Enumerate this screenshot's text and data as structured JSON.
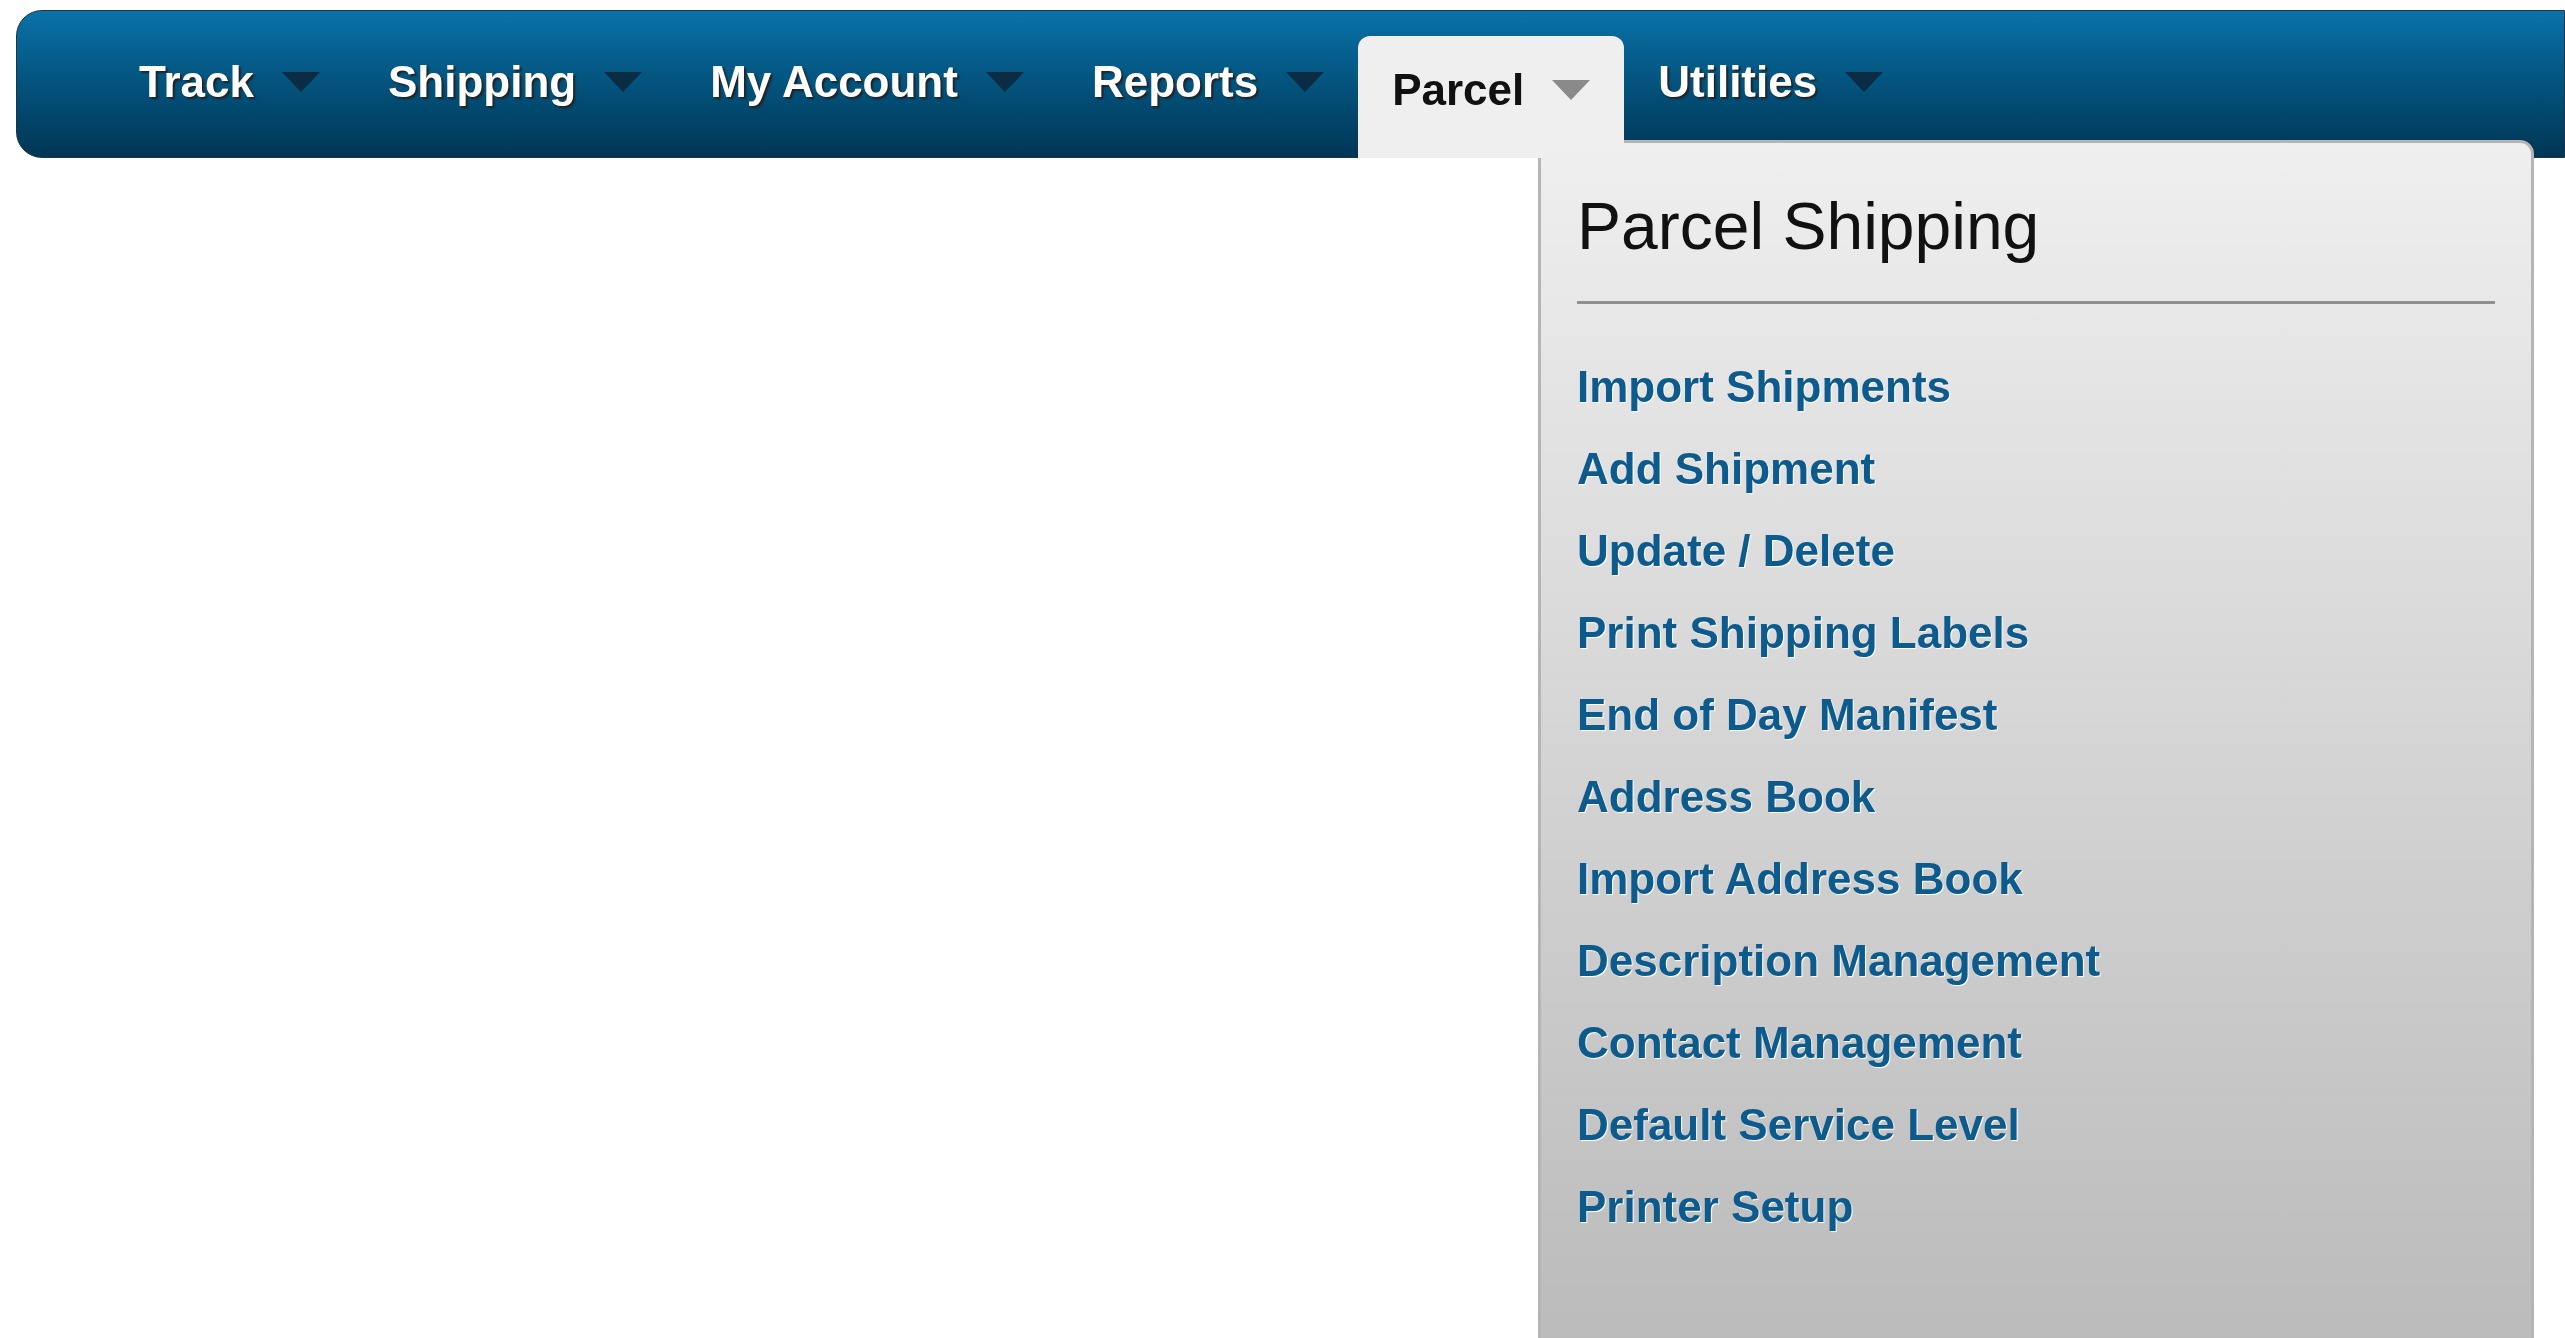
{
  "nav": {
    "items": [
      {
        "label": "Track",
        "selected": false
      },
      {
        "label": "Shipping",
        "selected": false
      },
      {
        "label": "My Account",
        "selected": false
      },
      {
        "label": "Reports",
        "selected": false
      },
      {
        "label": "Parcel",
        "selected": true
      },
      {
        "label": "Utilities",
        "selected": false
      }
    ]
  },
  "dropdown": {
    "title": "Parcel Shipping",
    "items": [
      "Import Shipments",
      "Add Shipment",
      "Update / Delete",
      "Print Shipping Labels",
      "End of Day Manifest",
      "Address Book",
      "Import Address Book",
      "Description Management",
      "Contact Management",
      "Default Service Level",
      "Printer Setup"
    ]
  }
}
